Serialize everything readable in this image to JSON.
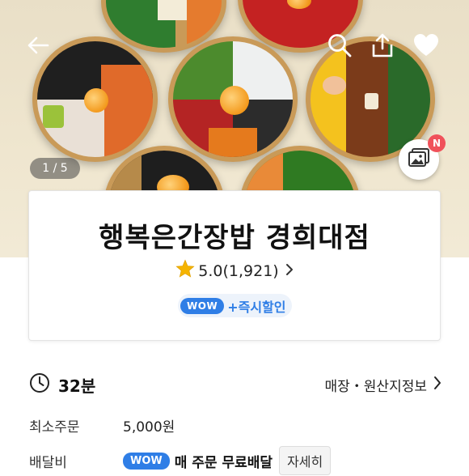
{
  "hero": {
    "photo_counter": "1 / 5",
    "new_badge": "N",
    "icons": [
      "back-arrow-icon",
      "search-icon",
      "share-icon",
      "heart-icon",
      "photo-gallery-icon"
    ]
  },
  "store": {
    "name": "행복은간장밥 경희대점",
    "rating": "5.0(1,921)",
    "promo_badge": "WOW",
    "promo_text": "+즉시할인"
  },
  "delivery_info": {
    "eta": "32분",
    "origin_link": "매장・원산지정보",
    "min_order_label": "최소주문",
    "min_order_value": "5,000원",
    "fee_label": "배달비",
    "fee_badge": "WOW",
    "fee_text": "매 주문 무료배달",
    "fee_detail_button": "자세히"
  },
  "colors": {
    "accent_blue": "#2f7ee6",
    "badge_red": "#f0515a",
    "star_yellow": "#f5b400"
  }
}
